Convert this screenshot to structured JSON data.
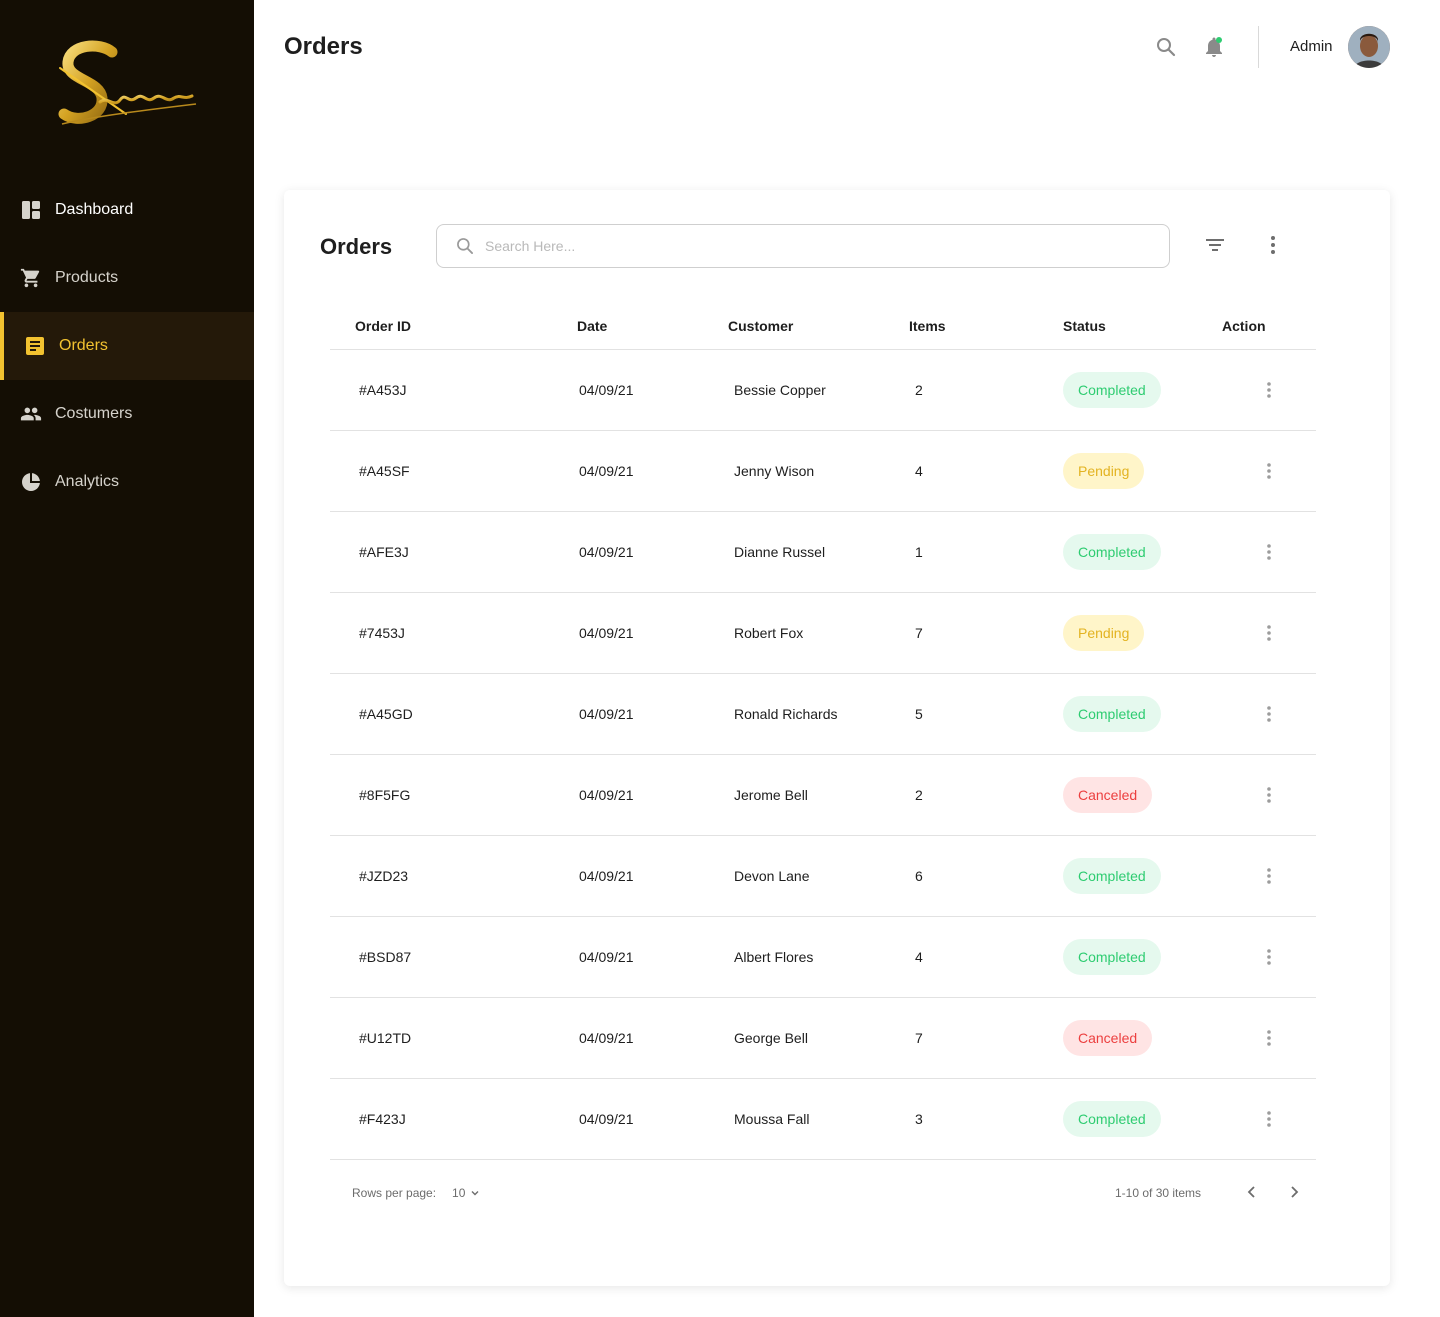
{
  "brand": {
    "logo_text": "Sansor",
    "accent": "#f2c230",
    "sidebar_bg": "#140e04"
  },
  "sidebar": {
    "items": [
      {
        "label": "Dashboard",
        "icon": "dashboard-icon"
      },
      {
        "label": "Products",
        "icon": "cart-icon"
      },
      {
        "label": "Orders",
        "icon": "orders-icon",
        "active": true
      },
      {
        "label": "Costumers",
        "icon": "people-icon"
      },
      {
        "label": "Analytics",
        "icon": "pie-chart-icon"
      }
    ]
  },
  "header": {
    "title": "Orders",
    "user_name": "Admin"
  },
  "card": {
    "title": "Orders",
    "search_placeholder": "Search Here...",
    "columns": [
      "Order ID",
      "Date",
      "Customer",
      "Items",
      "Status",
      "Action"
    ],
    "rows": [
      {
        "id": "#A453J",
        "date": "04/09/21",
        "customer": "Bessie Copper",
        "items": "2",
        "status": "Completed"
      },
      {
        "id": "#A45SF",
        "date": "04/09/21",
        "customer": "Jenny Wison",
        "items": "4",
        "status": "Pending"
      },
      {
        "id": "#AFE3J",
        "date": "04/09/21",
        "customer": "Dianne Russel",
        "items": "1",
        "status": "Completed"
      },
      {
        "id": "#7453J",
        "date": "04/09/21",
        "customer": "Robert Fox",
        "items": "7",
        "status": "Pending"
      },
      {
        "id": "#A45GD",
        "date": "04/09/21",
        "customer": "Ronald Richards",
        "items": "5",
        "status": "Completed"
      },
      {
        "id": "#8F5FG",
        "date": "04/09/21",
        "customer": "Jerome Bell",
        "items": "2",
        "status": "Canceled"
      },
      {
        "id": "#JZD23",
        "date": "04/09/21",
        "customer": "Devon Lane",
        "items": "6",
        "status": "Completed"
      },
      {
        "id": "#BSD87",
        "date": "04/09/21",
        "customer": "Albert Flores",
        "items": "4",
        "status": "Completed"
      },
      {
        "id": "#U12TD",
        "date": "04/09/21",
        "customer": "George Bell",
        "items": "7",
        "status": "Canceled"
      },
      {
        "id": "#F423J",
        "date": "04/09/21",
        "customer": "Moussa Fall",
        "items": "3",
        "status": "Completed"
      }
    ],
    "pagination": {
      "rows_per_page_label": "Rows per page:",
      "rows_per_page_value": "10",
      "range_text": "1-10 of 30 items"
    }
  },
  "status_colors": {
    "Completed": {
      "bg": "#e5f9ee",
      "fg": "#2ecc71"
    },
    "Pending": {
      "bg": "#fff5c9",
      "fg": "#e3b321"
    },
    "Canceled": {
      "bg": "#ffe4e4",
      "fg": "#ec3f3f"
    }
  }
}
